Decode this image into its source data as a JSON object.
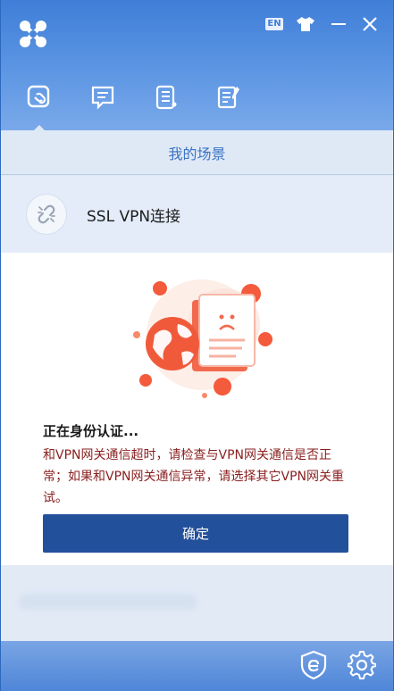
{
  "window": {
    "lang_badge": "EN"
  },
  "nav": {
    "items": [
      {
        "icon": "scene-link-icon",
        "active": true
      },
      {
        "icon": "message-icon",
        "active": false
      },
      {
        "icon": "list-doc-icon",
        "active": false
      },
      {
        "icon": "notes-edit-icon",
        "active": false
      }
    ]
  },
  "scene": {
    "title": "我的场景"
  },
  "vpn": {
    "icon": "broken-link-icon",
    "label": "SSL VPN连接"
  },
  "dialog": {
    "title": "正在身份认证...",
    "message": "和VPN网关通信超时，请检查与VPN网关通信是否正常；如果和VPN网关通信异常，请选择其它VPN网关重试。",
    "ok_label": "确定",
    "illustration": "globe-document-error-illustration"
  },
  "footer": {
    "icons": [
      "shield-e-icon",
      "gear-icon"
    ]
  },
  "colors": {
    "header": "#3f7ed8",
    "accent_text": "#3a73c4",
    "button": "#23509a",
    "message_text": "#8a1f1f",
    "illustration_red": "#f0563a"
  }
}
